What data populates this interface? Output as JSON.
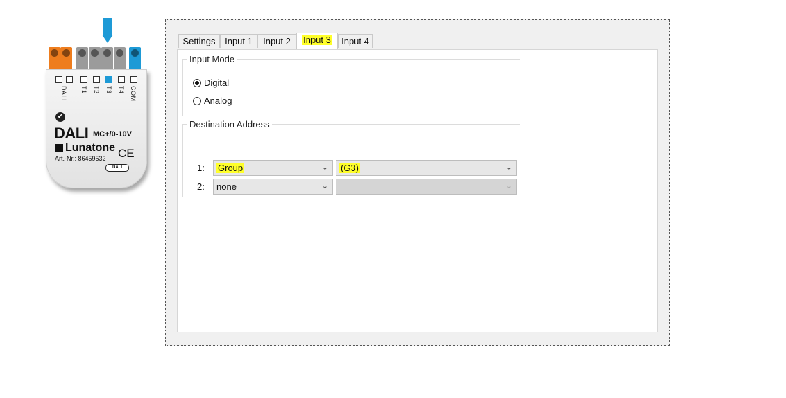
{
  "device": {
    "terminal_labels": [
      "DALI",
      "T1",
      "T2",
      "T3",
      "T4",
      "COM"
    ],
    "brand": "DALI",
    "model": "MC+/0-10V",
    "manufacturer": "Lunatone",
    "ce_mark": "CE",
    "article_number": "Art.-Nr.: 86459532",
    "badge": "DALI",
    "colors": {
      "orange": "#ee7d1e",
      "grey": "#9b9b9b",
      "blue": "#1e9ad6"
    },
    "active_terminal": "T3"
  },
  "tabs": [
    {
      "label": "Settings",
      "selected": false
    },
    {
      "label": "Input 1",
      "selected": false
    },
    {
      "label": "Input 2",
      "selected": false
    },
    {
      "label": "Input 3",
      "selected": true
    },
    {
      "label": "Input 4",
      "selected": false
    }
  ],
  "input_mode": {
    "title": "Input Mode",
    "options": [
      {
        "label": "Digital",
        "checked": true
      },
      {
        "label": "Analog",
        "checked": false
      }
    ]
  },
  "destination": {
    "title": "Destination Address",
    "rows": [
      {
        "label": "1:",
        "type": "Group",
        "address": "(G3)"
      },
      {
        "label": "2:",
        "type": "none",
        "address": ""
      }
    ]
  },
  "highlight_color": "#ffff2a"
}
